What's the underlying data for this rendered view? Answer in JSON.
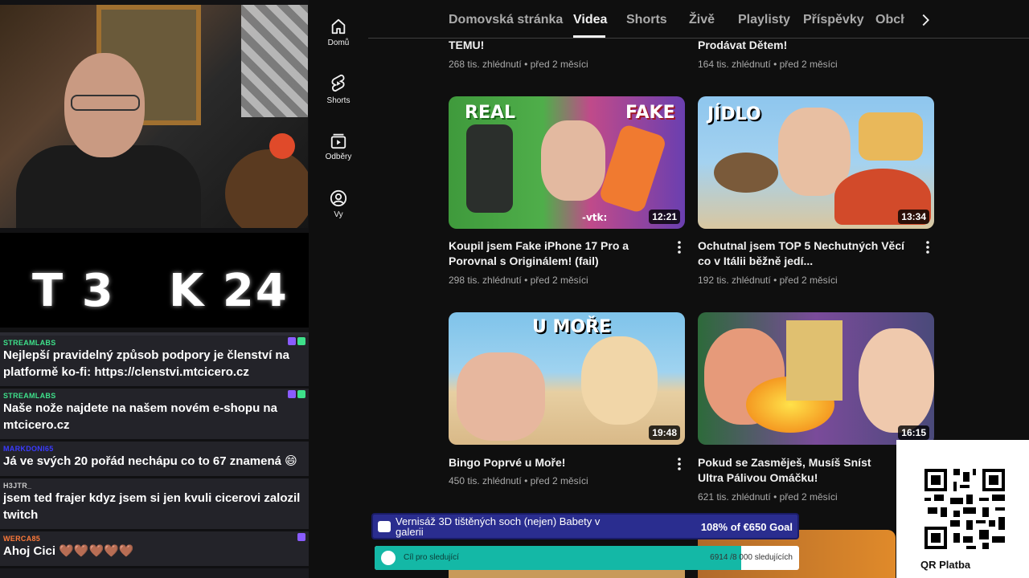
{
  "stream": {
    "score": {
      "t": "T 3",
      "k": "K 24"
    },
    "chat": [
      {
        "user": "STREAMLABS",
        "color": "#3ee08a",
        "text": "Nejlepší pravidelný způsob podpory je členství na platformě ko-fi: https://clenstvi.mtcicero.cz"
      },
      {
        "user": "STREAMLABS",
        "color": "#3ee08a",
        "text": "Naše nože najdete na našem novém e-shopu na mtcicero.cz"
      },
      {
        "user": "MARKDONI65",
        "color": "#3a3aff",
        "text": "Já ve svých 20 pořád nechápu co to 67 znamená 😄"
      },
      {
        "user": "H3JTR_",
        "color": "#c9c9c9",
        "text": "jsem ted frajer kdyz jsem si jen kvuli cicerovi zalozil twitch"
      },
      {
        "user": "WERCA85",
        "color": "#ff7a3a",
        "text": "Ahoj Cici 🤎🤎🤎🤎🤎"
      }
    ]
  },
  "sidebar": {
    "items": [
      {
        "label": "Domů",
        "icon": "home-icon"
      },
      {
        "label": "Shorts",
        "icon": "shorts-icon"
      },
      {
        "label": "Odběry",
        "icon": "subscriptions-icon"
      },
      {
        "label": "Vy",
        "icon": "account-icon"
      }
    ]
  },
  "tabs": [
    {
      "label": "Domovská stránka"
    },
    {
      "label": "Videa",
      "active": true
    },
    {
      "label": "Shorts"
    },
    {
      "label": "Živě"
    },
    {
      "label": "Playlisty"
    },
    {
      "label": "Příspěvky"
    },
    {
      "label": "Obch"
    }
  ],
  "videos": [
    {
      "title": "TEMU!",
      "views": "268 tis. zhlédnutí",
      "age": "před 2 měsíci"
    },
    {
      "title": "Prodávat Dětem!",
      "views": "164 tis. zhlédnutí",
      "age": "před 2 měsíci"
    },
    {
      "title": "Koupil jsem Fake iPhone 17 Pro a Porovnal s Originálem! (fail)",
      "views": "298 tis. zhlédnutí",
      "age": "před 2 měsíci",
      "duration": "12:21",
      "labels": [
        "REAL",
        "FAKE",
        "-vtk:"
      ]
    },
    {
      "title": "Ochutnal jsem TOP 5 Nechutných Věcí co v Itálii běžně jedí...",
      "views": "192 tis. zhlédnutí",
      "age": "před 2 měsíci",
      "duration": "13:34",
      "labels": [
        "JÍDLO"
      ]
    },
    {
      "title": "Bingo Poprvé u Moře!",
      "views": "450 tis. zhlédnutí",
      "age": "před 2 měsíci",
      "duration": "19:48",
      "labels": [
        "U MOŘE"
      ]
    },
    {
      "title": "Pokud se Zasměješ, Musíš Sníst Ultra Pálivou Omáčku!",
      "views": "621 tis. zhlédnutí",
      "age": "před 2 měsíci",
      "duration": "16:15",
      "labels": []
    }
  ],
  "meta_separator": "•",
  "overlays": {
    "donation": {
      "text": "Vernisáž 3D tištěných soch (nejen) Babety v galerii",
      "goal": "108% of €650 Goal"
    },
    "follow": {
      "label": "Cíl pro sledující",
      "count": "6914 /8 000 sledujících",
      "progress": 0.864
    },
    "qr": {
      "label": "QR Platba"
    }
  }
}
